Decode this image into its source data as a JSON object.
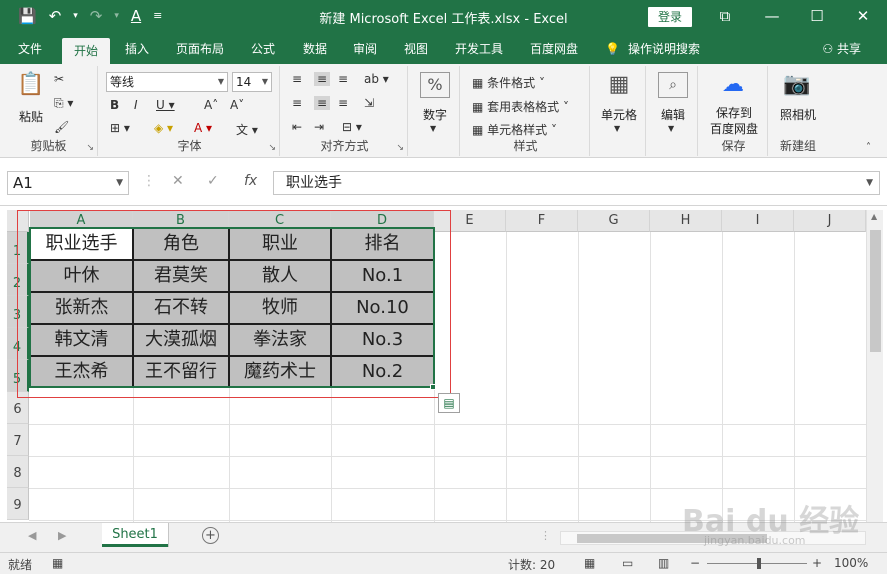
{
  "titlebar": {
    "title": "新建 Microsoft Excel 工作表.xlsx  -  Excel",
    "login": "登录",
    "qat": [
      "💾",
      "↶",
      "▾",
      "↷",
      "▾",
      "A",
      "≡"
    ]
  },
  "window_controls": [
    "⧉",
    "—",
    "☐",
    "✕"
  ],
  "tabs": [
    "文件",
    "开始",
    "插入",
    "页面布局",
    "公式",
    "数据",
    "审阅",
    "视图",
    "开发工具",
    "百度网盘"
  ],
  "help": {
    "icon": "💡",
    "label": "操作说明搜索"
  },
  "share": "⚇ 共享",
  "ribbon": {
    "clipboard": {
      "label": "剪贴板",
      "paste": "粘贴"
    },
    "font": {
      "label": "字体",
      "name": "等线",
      "size": "14"
    },
    "alignment": {
      "label": "对齐方式"
    },
    "number": {
      "label": "数字",
      "icon": "%"
    },
    "styles": {
      "label": "样式",
      "conditional": "条件格式 ˅",
      "table": "套用表格格式 ˅",
      "cell": "单元格样式 ˅"
    },
    "cells": {
      "label": "单元格"
    },
    "editing": {
      "label": "编辑"
    },
    "baidu": {
      "save": "保存到",
      "save2": "百度网盘",
      "label": "保存"
    },
    "camera": {
      "label1": "照相机",
      "label2": "新建组"
    }
  },
  "formula_bar": {
    "name_box": "A1",
    "cancel": "✕",
    "enter": "✓",
    "fx": "fx",
    "value": "职业选手"
  },
  "columns": [
    "A",
    "B",
    "C",
    "D",
    "E",
    "F",
    "G",
    "H",
    "I",
    "J"
  ],
  "rows": [
    "1",
    "2",
    "3",
    "4",
    "5",
    "6",
    "7",
    "8",
    "9"
  ],
  "table": [
    [
      "职业选手",
      "角色",
      "职业",
      "排名"
    ],
    [
      "叶休",
      "君莫笑",
      "散人",
      "No.1"
    ],
    [
      "张新杰",
      "石不转",
      "牧师",
      "No.10"
    ],
    [
      "韩文清",
      "大漠孤烟",
      "拳法家",
      "No.3"
    ],
    [
      "王杰希",
      "王不留行",
      "魔药术士",
      "No.2"
    ]
  ],
  "sheet": {
    "name": "Sheet1",
    "add": "+"
  },
  "status": {
    "ready": "就绪",
    "count": "计数: 20",
    "zoom": "100%",
    "minus": "−",
    "plus": "+"
  },
  "watermark": {
    "main": "Bai du 经验",
    "sub": "jingyan.baidu.com"
  },
  "colors": {
    "accent": "#217346",
    "selection_fill": "#c0c0c0",
    "annotation": "#e04040"
  }
}
